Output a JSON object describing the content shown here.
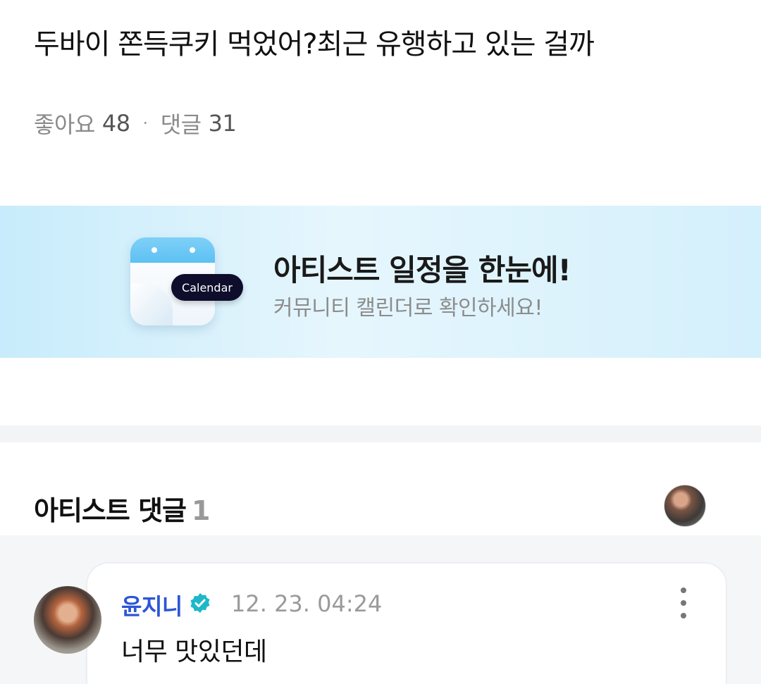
{
  "post": {
    "title": "두바이 쫀득쿠키 먹었어?최근 유행하고 있는 걸까",
    "likes_label": "좋아요",
    "likes_count": "48",
    "separator": "·",
    "comments_label": "댓글",
    "comments_count": "31"
  },
  "banner": {
    "badge": "Calendar",
    "title": "아티스트 일정을 한눈에!",
    "subtitle": "커뮤니티 캘린더로 확인하세요!",
    "icon": "calendar-icon",
    "colors": {
      "background": "#d4f0fc",
      "badge_bg": "#0e0e2c",
      "calendar_header": "#5cc1f3"
    }
  },
  "artist_comments": {
    "title": "아티스트 댓글",
    "count": "1"
  },
  "comment": {
    "author": "윤지니",
    "verified_icon": "verified-badge-icon",
    "timestamp": "12. 23. 04:24",
    "text": "너무 맛있던데",
    "more_icon": "more-vertical-icon",
    "colors": {
      "author": "#2b56d6",
      "verified": "#1eb8c9"
    }
  }
}
